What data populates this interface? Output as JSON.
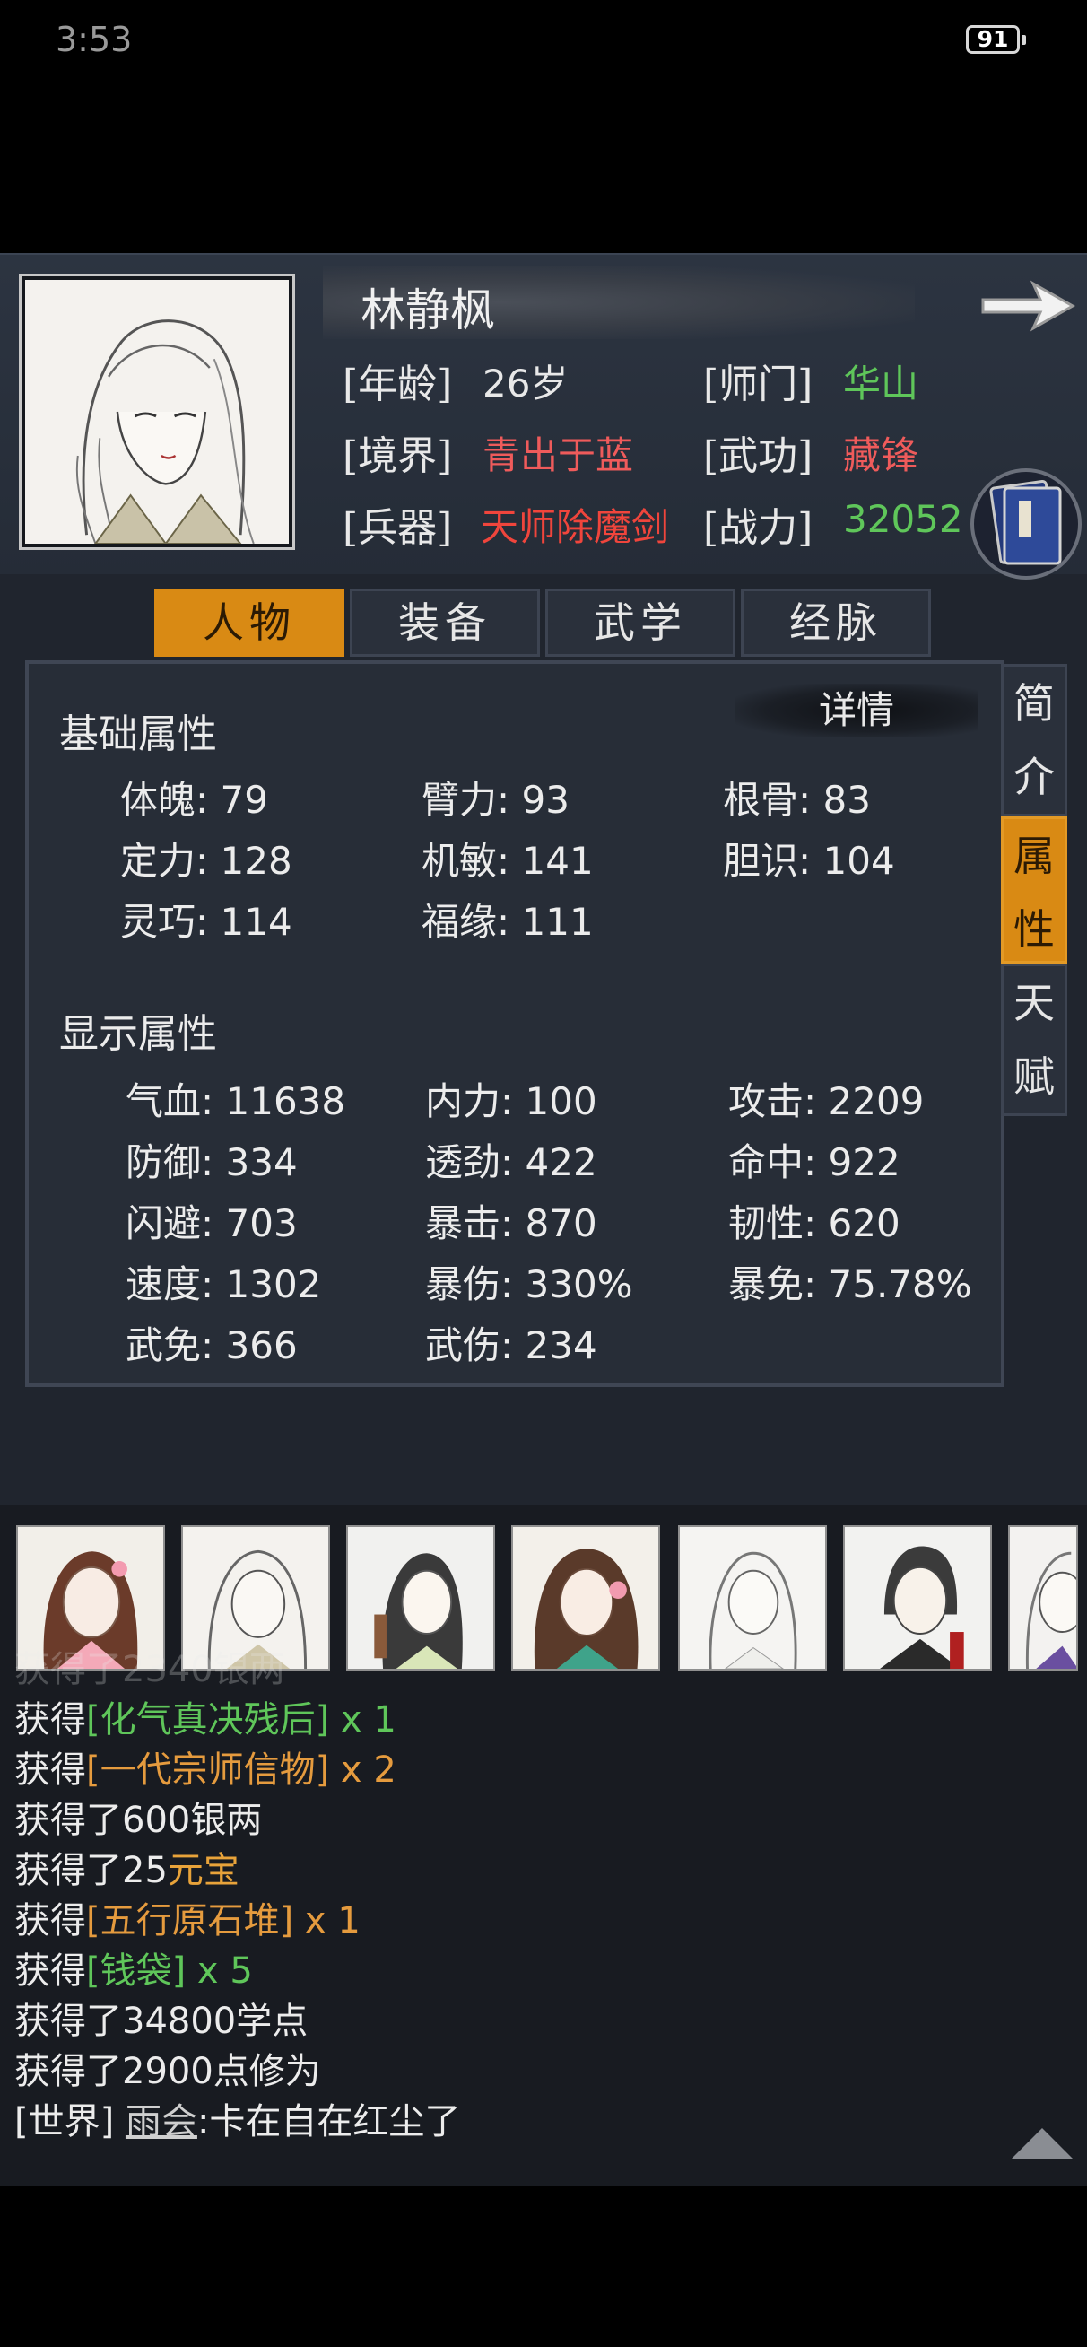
{
  "status_bar": {
    "time": "3:53",
    "battery": "91"
  },
  "character": {
    "name": "林静枫",
    "age_label": "[年龄]",
    "age": "26岁",
    "sect_label": "[师门]",
    "sect": "华山",
    "realm_label": "[境界]",
    "realm": "青出于蓝",
    "skill_label": "[武功]",
    "skill": "藏锋",
    "weapon_label": "[兵器]",
    "weapon": "天师除魔剑",
    "power_label": "[战力]",
    "power": "32052"
  },
  "tabs": [
    "人物",
    "装备",
    "武学",
    "经脉"
  ],
  "side_tabs": [
    {
      "chars": [
        "简",
        "介"
      ],
      "active": false
    },
    {
      "chars": [
        "属",
        "性"
      ],
      "active": true
    },
    {
      "chars": [
        "天",
        "赋"
      ],
      "active": false
    }
  ],
  "detail_label": "详情",
  "basic": {
    "title": "基础属性",
    "items": [
      "体魄: 79",
      "臂力: 93",
      "根骨: 83",
      "定力: 128",
      "机敏: 141",
      "胆识: 104",
      "灵巧: 114",
      "福缘: 111"
    ]
  },
  "display": {
    "title": "显示属性",
    "items": [
      "气血: 11638",
      "内力: 100",
      "攻击: 2209",
      "防御: 334",
      "透劲: 422",
      "命中: 922",
      "闪避: 703",
      "暴击: 870",
      "韧性: 620",
      "速度: 1302",
      "暴伤: 330%",
      "暴免: 75.78%",
      "武免: 366",
      "武伤: 234"
    ]
  },
  "log": {
    "partial_top": "获得了2340银两",
    "lines": [
      {
        "prefix": "获得",
        "item": "[化气真决残后]",
        "suffix": " x 1",
        "color": "green"
      },
      {
        "prefix": "获得",
        "item": "[一代宗师信物]",
        "suffix": " x 2",
        "color": "orange"
      },
      {
        "prefix": "获得了600银两",
        "item": "",
        "suffix": "",
        "color": ""
      },
      {
        "prefix": "获得了25",
        "item": "元宝",
        "suffix": "",
        "color": "gold"
      },
      {
        "prefix": "获得",
        "item": "[五行原石堆]",
        "suffix": " x 1",
        "color": "orange"
      },
      {
        "prefix": "获得",
        "item": "[钱袋]",
        "suffix": " x 5",
        "color": "green"
      },
      {
        "prefix": "获得了34800学点",
        "item": "",
        "suffix": "",
        "color": ""
      },
      {
        "prefix": "获得了2900点修为",
        "item": "",
        "suffix": "",
        "color": ""
      }
    ],
    "chat": {
      "channel": "[世界]",
      "user": "雨会",
      "message": ":卡在自在红尘了"
    }
  },
  "colors": {
    "accent": "#d98a14",
    "green": "#5fc65a",
    "red": "#f0453c",
    "orange": "#e59b3e"
  },
  "icons": [
    "arrow-right-icon",
    "book-icon",
    "scroll-up-icon"
  ]
}
